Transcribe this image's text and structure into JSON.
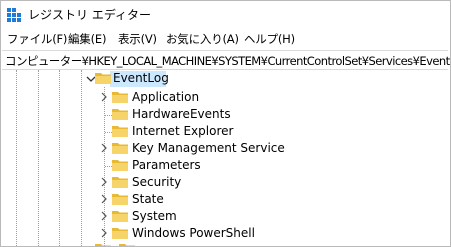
{
  "window": {
    "title": "レジストリ エディター"
  },
  "menu": {
    "items": [
      {
        "label": "ファイル(F)"
      },
      {
        "label": "編集(E)"
      },
      {
        "label": "表示(V)"
      },
      {
        "label": "お気に入り(A)"
      },
      {
        "label": "ヘルプ(H)"
      }
    ]
  },
  "address": {
    "path": "コンピューター¥HKEY_LOCAL_MACHINE¥SYSTEM¥CurrentControlSet¥Services¥EventLog"
  },
  "tree": {
    "parent": {
      "label": "EventLog",
      "expanded": true,
      "selected": true
    },
    "children": [
      {
        "label": "Application",
        "has_children": true
      },
      {
        "label": "HardwareEvents",
        "has_children": false
      },
      {
        "label": "Internet Explorer",
        "has_children": false
      },
      {
        "label": "Key Management Service",
        "has_children": true
      },
      {
        "label": "Parameters",
        "has_children": false
      },
      {
        "label": "Security",
        "has_children": true
      },
      {
        "label": "State",
        "has_children": true
      },
      {
        "label": "System",
        "has_children": true
      },
      {
        "label": "Windows PowerShell",
        "has_children": true
      }
    ]
  },
  "colors": {
    "selection": "#cce8ff",
    "folder": "#f7d469",
    "icon_blue": "#1e7bd7"
  }
}
